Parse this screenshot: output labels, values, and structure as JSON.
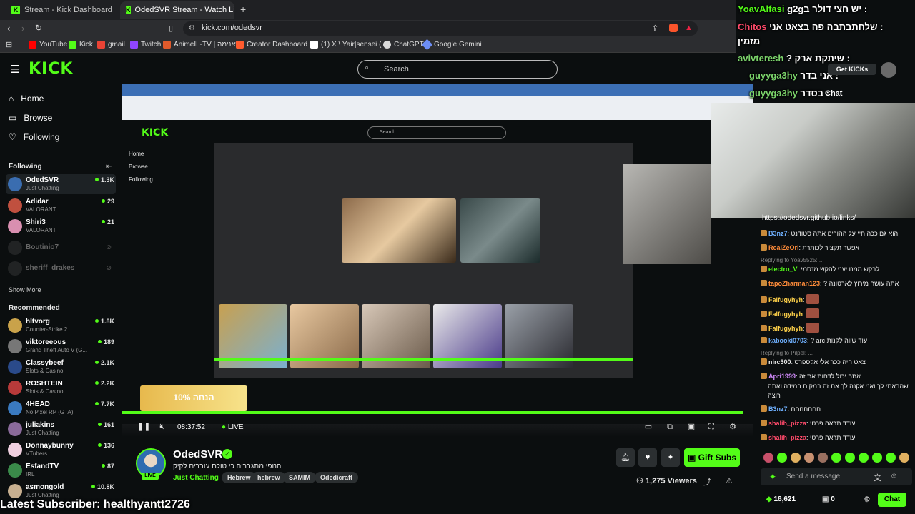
{
  "browser": {
    "tabs": [
      {
        "label": "Stream - Kick Dashboard",
        "active": false
      },
      {
        "label": "OdedSVR Stream - Watch Live o",
        "active": true
      }
    ],
    "address": "kick.com/odedsvr",
    "bookmarks": [
      {
        "label": "YouTube",
        "color": "#ff0000"
      },
      {
        "label": "Kick",
        "color": "#53fc18"
      },
      {
        "label": "gmail",
        "color": "#ea4335"
      },
      {
        "label": "Twitch",
        "color": "#9146ff"
      },
      {
        "label": "AnimeIL-TV | אנימה...",
        "color": "#e05a2b"
      },
      {
        "label": "Creator Dashboard |...",
        "color": "#ff5b2e"
      },
      {
        "label": "(1) X \\ Yair|sensei (...",
        "color": "#ffffff"
      },
      {
        "label": "ChatGPT",
        "color": "#d9d9d9"
      },
      {
        "label": "Google Gemini",
        "color": "#6c8df5"
      }
    ]
  },
  "header": {
    "logo": "KICK",
    "search_placeholder": "Search",
    "get_kicks": "Get KICKs"
  },
  "sidebar": {
    "nav": [
      {
        "label": "Home",
        "icon": "home-icon"
      },
      {
        "label": "Browse",
        "icon": "browse-icon"
      },
      {
        "label": "Following",
        "icon": "heart-icon"
      }
    ],
    "following_title": "Following",
    "following": [
      {
        "name": "OdedSVR",
        "game": "Just Chatting",
        "viewers": "1.3K",
        "color": "#3a6db0"
      },
      {
        "name": "Adidar",
        "game": "VALORANT",
        "viewers": "29",
        "color": "#c0503f"
      },
      {
        "name": "Shiri3",
        "game": "VALORANT",
        "viewers": "21",
        "color": "#d98fb0"
      },
      {
        "name": "Boutinio7",
        "game": "",
        "viewers": "",
        "color": "#444"
      },
      {
        "name": "sheriff_drakes",
        "game": "",
        "viewers": "",
        "color": "#444"
      }
    ],
    "show_more": "Show More",
    "recommended_title": "Recommended",
    "recommended": [
      {
        "name": "hltvorg",
        "game": "Counter-Strike 2",
        "viewers": "1.8K",
        "color": "#c9a24a"
      },
      {
        "name": "viktoreeous",
        "game": "Grand Theft Auto V (G...",
        "viewers": "189",
        "color": "#777"
      },
      {
        "name": "Classybeef",
        "game": "Slots & Casino",
        "viewers": "2.1K",
        "color": "#2a4a8a"
      },
      {
        "name": "ROSHTEIN",
        "game": "Slots & Casino",
        "viewers": "2.2K",
        "color": "#b83a3a"
      },
      {
        "name": "4HEAD",
        "game": "No Pixel RP (GTA)",
        "viewers": "7.7K",
        "color": "#3a7ac0"
      },
      {
        "name": "juliakins",
        "game": "Just Chatting",
        "viewers": "161",
        "color": "#8a6a9a"
      },
      {
        "name": "Donnaybunny",
        "game": "VTubers",
        "viewers": "136",
        "color": "#f0d0e0"
      },
      {
        "name": "EsfandTV",
        "game": "IRL",
        "viewers": "87",
        "color": "#3a8a4a"
      },
      {
        "name": "asmongold",
        "game": "Just Chatting",
        "viewers": "10.8K",
        "color": "#c8b090"
      }
    ]
  },
  "player": {
    "time": "08:37:52",
    "live": "LIVE",
    "promo": "10% הנחה"
  },
  "streamer": {
    "name": "OdedSVR",
    "title": "הנופי מתגברים כי טולם עוברים לקיק",
    "category": "Just Chatting",
    "tags": [
      "Hebrew",
      "hebrew",
      "SAMIM",
      "Odedicraft"
    ],
    "gift_subs": "Gift Subs",
    "viewers": "1,275 Viewers"
  },
  "overlay_chat": [
    {
      "user": "YoavAlfasi",
      "text": "g2gיש חצי דולר ב :"
    },
    {
      "user": "Chitos",
      "text": "שלחתבתבה פה בצאט אני :"
    },
    {
      "user": "",
      "text": "מזמין"
    },
    {
      "user": "avivteresh",
      "text": "? שיתקת ארק :"
    },
    {
      "user": "guyyga3hy",
      "text": "אני בדר :"
    },
    {
      "user": "guyyga3hy",
      "text": "בסדר :"
    }
  ],
  "chat": {
    "title": "Chat",
    "link": "https://odedsvr.github.io/links/",
    "messages": [
      {
        "user": "B3nz7",
        "text": "הוא גם ככה חיי על ההורים אתה סטודנט",
        "color": "#6fb0ff"
      },
      {
        "user": "RealZeOri",
        "text": "אפשר תקציר לכותרת",
        "color": "#ff8c3a"
      },
      {
        "user": "electro_V",
        "text": "לבקש ממנו יעני להקש מנסמי",
        "color": "#53fc18",
        "reply": "Replying to Yoav5525: ..."
      },
      {
        "user": "tapoZharman123",
        "text": "? אתה עושה מירוץ לארטונה",
        "color": "#ff8c3a"
      },
      {
        "user": "Falfugyhyh",
        "text": "",
        "color": "#ffd24a"
      },
      {
        "user": "Falfugyhyh",
        "text": "",
        "color": "#ffd24a"
      },
      {
        "user": "Falfugyhyh",
        "text": "",
        "color": "#ffd24a"
      },
      {
        "user": "kabooki0703",
        "text": "? arc עוד שווה לקנות",
        "color": "#6fb0ff"
      },
      {
        "user": "nirc300",
        "text": "צאט היה ככר אלי אקספרס",
        "color": "#e6e6e6",
        "reply": "Replying to Pilpel: ..."
      },
      {
        "user": "Apri1999",
        "text": "אתה יכול לדחות את זה",
        "color": "#d48cff"
      },
      {
        "user": "",
        "text": "שהבאתי לך ואני אקנה לך את זה במקום במידה ואתה",
        "color": "#e6e6e6"
      },
      {
        "user": "",
        "text": "רוצה",
        "color": "#e6e6e6"
      },
      {
        "user": "B3nz7",
        "text": "חחחחחחח",
        "color": "#6fb0ff"
      },
      {
        "user": "shalih_pizza",
        "text": "עודד תראה פרטי",
        "color": "#ff4a6a"
      },
      {
        "user": "shalih_pizza",
        "text": "עודד תראה פרטי",
        "color": "#ff4a6a"
      }
    ],
    "input_placeholder": "Send a message",
    "points": "18,621",
    "second_count": "0",
    "send": "Chat"
  },
  "latest_subscriber": "Latest Subscriber: healthyantt2726"
}
